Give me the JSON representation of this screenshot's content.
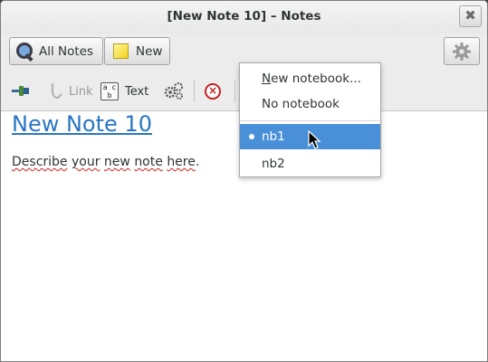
{
  "window": {
    "title": "[New Note 10] – Notes",
    "close_glyph": "✖"
  },
  "toolbar": {
    "all_notes_label": "All Notes",
    "new_label": "New",
    "settings_icon": "gear-icon"
  },
  "format_toolbar": {
    "link_label": "Link",
    "text_label": "Text",
    "abc_glyph": "a c b",
    "delete_glyph": "×"
  },
  "note": {
    "title": "New Note 10",
    "body_words": [
      "Describe",
      " ",
      "your",
      " ",
      "new",
      " ",
      "note",
      " ",
      "here",
      "."
    ]
  },
  "notebook_menu": {
    "items": [
      {
        "label": "New notebook...",
        "mnemonic": "N"
      },
      {
        "label": "No notebook"
      },
      {
        "label": "nb1",
        "selected": true
      },
      {
        "label": "nb2"
      }
    ]
  },
  "colors": {
    "accent": "#4a90d9",
    "link": "#2a76c6",
    "delete": "#c42020"
  }
}
